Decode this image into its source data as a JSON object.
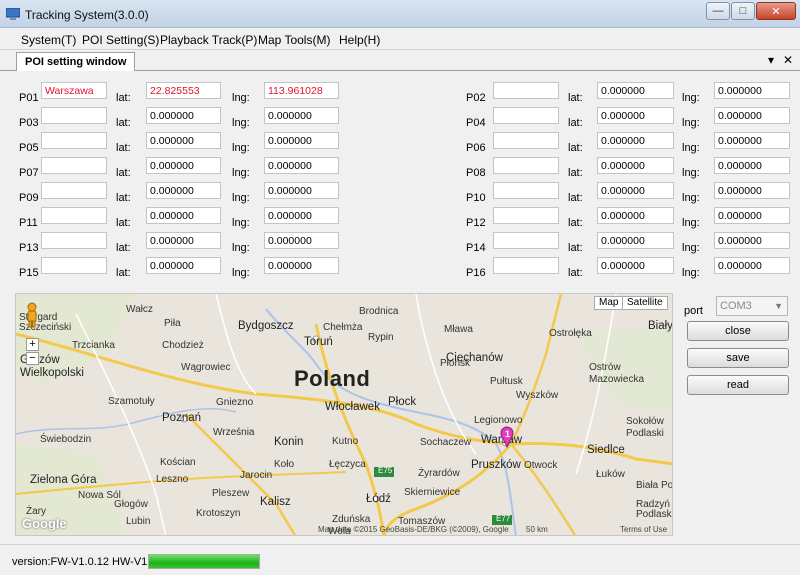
{
  "window": {
    "title": "Tracking System(3.0.0)",
    "minimize": "—",
    "maximize": "□",
    "close": "✕"
  },
  "menu": [
    {
      "label": "System(T)"
    },
    {
      "label": "POI Setting(S)"
    },
    {
      "label": "Playback Track(P)"
    },
    {
      "label": "Map Tools(M)"
    },
    {
      "label": "Help(H)"
    }
  ],
  "tab": {
    "label": "POI setting window",
    "dropdown": "▾",
    "close": "✕"
  },
  "poi": {
    "lat_label": "lat:",
    "lng_label": "lng:",
    "left": [
      {
        "id": "P01",
        "name": "Warszawa",
        "lat": "22.825553",
        "lng": "113.961028"
      },
      {
        "id": "P03",
        "name": "",
        "lat": "0.000000",
        "lng": "0.000000"
      },
      {
        "id": "P05",
        "name": "",
        "lat": "0.000000",
        "lng": "0.000000"
      },
      {
        "id": "P07",
        "name": "",
        "lat": "0.000000",
        "lng": "0.000000"
      },
      {
        "id": "P09",
        "name": "",
        "lat": "0.000000",
        "lng": "0.000000"
      },
      {
        "id": "P11",
        "name": "",
        "lat": "0.000000",
        "lng": "0.000000"
      },
      {
        "id": "P13",
        "name": "",
        "lat": "0.000000",
        "lng": "0.000000"
      },
      {
        "id": "P15",
        "name": "",
        "lat": "0.000000",
        "lng": "0.000000"
      }
    ],
    "right": [
      {
        "id": "P02",
        "name": "",
        "lat": "0.000000",
        "lng": "0.000000"
      },
      {
        "id": "P04",
        "name": "",
        "lat": "0.000000",
        "lng": "0.000000"
      },
      {
        "id": "P06",
        "name": "",
        "lat": "0.000000",
        "lng": "0.000000"
      },
      {
        "id": "P08",
        "name": "",
        "lat": "0.000000",
        "lng": "0.000000"
      },
      {
        "id": "P10",
        "name": "",
        "lat": "0.000000",
        "lng": "0.000000"
      },
      {
        "id": "P12",
        "name": "",
        "lat": "0.000000",
        "lng": "0.000000"
      },
      {
        "id": "P14",
        "name": "",
        "lat": "0.000000",
        "lng": "0.000000"
      },
      {
        "id": "P16",
        "name": "",
        "lat": "0.000000",
        "lng": "0.000000"
      }
    ]
  },
  "map": {
    "type_map": "Map",
    "type_satellite": "Satellite",
    "zoom_in": "+",
    "zoom_out": "−",
    "country": "Poland",
    "marker_label": "1",
    "attribution": "Map data ©2015 GeoBasis-DE/BKG (©2009), Google",
    "scale": "50 km",
    "terms": "Terms of Use",
    "logo": "Google",
    "cities": [
      "Stargard",
      "Szczeciński",
      "Wałcz",
      "Piła",
      "Bydgoszcz",
      "Chełmża",
      "Brodnica",
      "Mława",
      "Ostrołęka",
      "Biały",
      "Trzcianka",
      "Chodzież",
      "Toruń",
      "Rypin",
      "Ciechanów",
      "Ostrów",
      "Gorzów",
      "Wielkopolski",
      "Wągrowiec",
      "Płońsk",
      "Pułtusk",
      "Mazowiecka",
      "Szamotuły",
      "Gniezno",
      "Włocławek",
      "Płock",
      "Wyszków",
      "Poznań",
      "Września",
      "Legionowo",
      "Siedlce",
      "Świebodzin",
      "Konin",
      "Kutno",
      "Sochaczew",
      "Warsaw",
      "Sokołów",
      "Podlaski",
      "Zielona Góra",
      "Kościan",
      "Koło",
      "Łęczyca",
      "Żyrardów",
      "Pruszków",
      "Otwock",
      "Łuków",
      "Nowa Sól",
      "Leszno",
      "Jarocin",
      "Łódź",
      "Biała Podl",
      "Żary",
      "Głogów",
      "Pleszew",
      "Skierniewice",
      "Radzyń",
      "Kalisz",
      "Zduńska",
      "Tomaszów",
      "Podlaski",
      "Lubin",
      "Krotoszyn",
      "Wola"
    ],
    "roads": [
      "E75",
      "E77"
    ]
  },
  "controls": {
    "port_label": "port",
    "port_value": "COM3",
    "close_btn": "close",
    "save_btn": "save",
    "read_btn": "read"
  },
  "status": {
    "version": "version:FW-V1.0.12 HW-V1.5",
    "progress": 1.0
  },
  "colors": {
    "accent_red": "#e0162b",
    "progress_green": "#1fb21a",
    "water": "#a9c4e8",
    "road_major": "#f2c94c"
  }
}
